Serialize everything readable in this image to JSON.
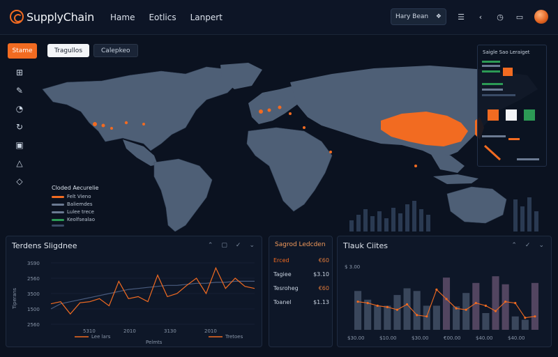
{
  "app": {
    "title": "SupplyChain"
  },
  "nav": {
    "items": [
      "Hame",
      "Eotlics",
      "Lanpert"
    ]
  },
  "topbar": {
    "search_label": "Hary Bean"
  },
  "sidebar": {
    "active_label": "Stame"
  },
  "map": {
    "tabs": [
      "Tragullos",
      "Calepkeo"
    ],
    "legend": {
      "title": "Cloded Aecurelie",
      "rows": [
        {
          "label": "Felt Vieno",
          "color": "#f26b21"
        },
        {
          "label": "Baliemdes",
          "color": "#6b7a92"
        },
        {
          "label": "Lulee trece",
          "color": "#6b7a92"
        },
        {
          "label": "Keolfsealao",
          "color": "#2c9a55"
        },
        {
          "label": "",
          "color": "#3a4b66"
        }
      ]
    },
    "overlay": {
      "title": "Saigle Sao Leraiget"
    }
  },
  "trend_panel": {
    "title": "Terdens Sligdnee",
    "ylabel": "Tiperans",
    "xlabel": "Pelmts",
    "legend": [
      "Lee lars",
      "Tretoes"
    ]
  },
  "summary_panel": {
    "title": "Sagrod Ledcden",
    "rows": [
      {
        "label": "Erced",
        "value": "€60"
      },
      {
        "label": "Tagiee",
        "value": "$3.10"
      },
      {
        "label": "Tesroheg",
        "value": "€60"
      },
      {
        "label": "Toanel",
        "value": "$1.13"
      }
    ]
  },
  "chart_data": [
    {
      "type": "line",
      "title": "Terdens Sligdnee",
      "xlabel": "Pelmts",
      "ylabel": "Tiperans",
      "x_ticks": [
        "5310",
        "2010",
        "3130",
        "2010"
      ],
      "y_ticks": [
        "3S90",
        "2560",
        "3500",
        "1500",
        "2560"
      ],
      "series": [
        {
          "name": "Lee lars",
          "color": "#f26b21",
          "values": [
            20,
            22,
            10,
            21,
            22,
            25,
            18,
            42,
            25,
            27,
            22,
            48,
            27,
            30,
            38,
            45,
            30,
            55,
            35,
            45,
            37,
            35
          ]
        },
        {
          "name": "Tretoes",
          "color": "#4a5c7e",
          "values": [
            15,
            20,
            22,
            24,
            26,
            28,
            30,
            32,
            34,
            35,
            36,
            37,
            38,
            38,
            39,
            40,
            40,
            41,
            41,
            42,
            42,
            42
          ]
        }
      ]
    },
    {
      "type": "bar",
      "title": "Tlauk Ciites",
      "x_ticks": [
        "$30.00",
        "$10.00",
        "$30.00",
        "€00.00",
        "$40.00",
        "$40.00"
      ],
      "y_ticks": [
        "$ 3.00"
      ],
      "values": [
        58,
        45,
        36,
        36,
        52,
        62,
        58,
        36,
        36,
        78,
        35,
        55,
        70,
        25,
        80,
        68,
        20,
        15,
        70
      ],
      "line_values": [
        42,
        40,
        36,
        34,
        30,
        38,
        22,
        20,
        60,
        46,
        32,
        30,
        40,
        36,
        28,
        42,
        40,
        18,
        20
      ]
    }
  ]
}
